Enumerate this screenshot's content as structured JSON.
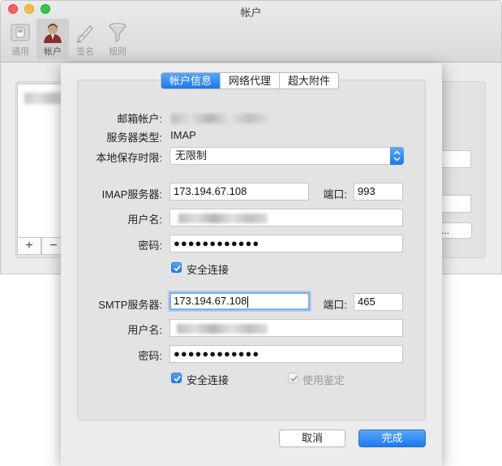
{
  "window": {
    "title": "帐户"
  },
  "toolbar": {
    "items": [
      {
        "label": "通用",
        "icon": "switch-icon"
      },
      {
        "label": "帐户",
        "icon": "user-icon"
      },
      {
        "label": "签名",
        "icon": "pen-icon"
      },
      {
        "label": "规则",
        "icon": "funnel-icon"
      }
    ],
    "active_index": 1
  },
  "background": {
    "add_label": "+",
    "remove_label": "−",
    "more_button_label": "..."
  },
  "sheet": {
    "tabs": [
      {
        "label": "帐户信息",
        "selected": true
      },
      {
        "label": "网络代理",
        "selected": false
      },
      {
        "label": "超大附件",
        "selected": false
      }
    ],
    "email_account": {
      "label": "邮箱帐户:"
    },
    "server_type": {
      "label": "服务器类型:",
      "value": "IMAP"
    },
    "local_keep": {
      "label": "本地保存时限:",
      "value": "无限制"
    },
    "imap": {
      "server_label": "IMAP服务器:",
      "server_value": "173.194.67.108",
      "port_label": "端口:",
      "port_value": "993",
      "username_label": "用户名:",
      "password_label": "密码:",
      "password_value": "●●●●●●●●●●●●",
      "secure_label": "安全连接",
      "secure_checked": true
    },
    "smtp": {
      "server_label": "SMTP服务器:",
      "server_value": "173.194.67.108",
      "port_label": "端口:",
      "port_value": "465",
      "username_label": "用户名:",
      "password_label": "密码:",
      "password_value": "●●●●●●●●●●●●",
      "secure_label": "安全连接",
      "secure_checked": true,
      "auth_label": "使用鉴定",
      "auth_checked": true
    },
    "buttons": {
      "cancel": "取消",
      "done": "完成"
    }
  }
}
